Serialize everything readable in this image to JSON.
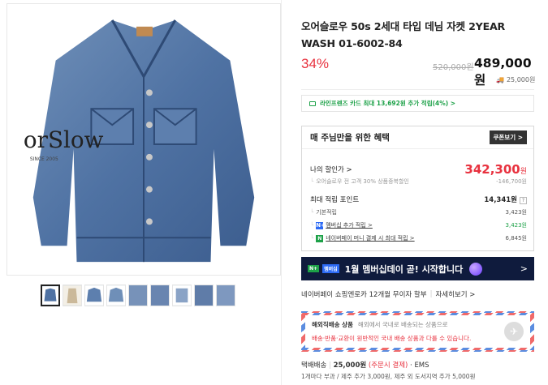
{
  "product": {
    "title": "오어슬로우 50s 2세대 타입 데님 자켓 2YEAR WASH 01-6002-84",
    "discount_rate": "34%",
    "original_price": "520,000원",
    "sale_price": "489,000원",
    "shipping_fee": "25,000원"
  },
  "brand_logo": {
    "text": "orSlow",
    "sub": "SINCE 2005"
  },
  "card_promo": "라인프렌즈 카드 최대 13,692원 추가 적립(4%) >",
  "benefit": {
    "heading": "매 주님만을 위한 혜택",
    "coupon_button": "쿠폰보기 >",
    "my_price_label": "나의 할인가 >",
    "my_price_value": "342,300",
    "my_price_unit": "원",
    "discount_desc": "오어슬로우 전 고객 30% 상품중복할인",
    "discount_amount": "-146,700원",
    "points_label": "최대 적립 포인트",
    "points_value": "14,341원",
    "points_help": "?",
    "basic_label": "기본적립",
    "basic_value": "3,423원",
    "member_badge": "N+",
    "member_label": "멤버십 추가 적립 >",
    "member_value": "3,423원",
    "npay_badge": "N",
    "npay_label": "네이버페이 머니 결제 시 최대 적립 >",
    "npay_value": "6,845원"
  },
  "banner": {
    "badge1": "N+",
    "badge2": "멤버십",
    "text": "1월 멤버십데이 곧! 시작합니다",
    "arrow": ">"
  },
  "payinfo": {
    "text": "네이버페이 쇼핑엔로카 12개월 무이자 할부",
    "link": "자세히보기 >"
  },
  "overseas": {
    "title": "해외직배송 상품",
    "desc": "해외에서 국내로 배송되는 상품으로",
    "warning": "배송·반품·교환이 원반적인 국내 배송 상품과 다를 수 있습니다."
  },
  "delivery": {
    "method": "택배배송",
    "fee": "25,000원",
    "fee_note": "(주문시 결제)",
    "carrier": "EMS",
    "extra": "1개마다 부과 / 제주 추가 3,000원, 제주 외 도서지역 추가 5,000원"
  }
}
